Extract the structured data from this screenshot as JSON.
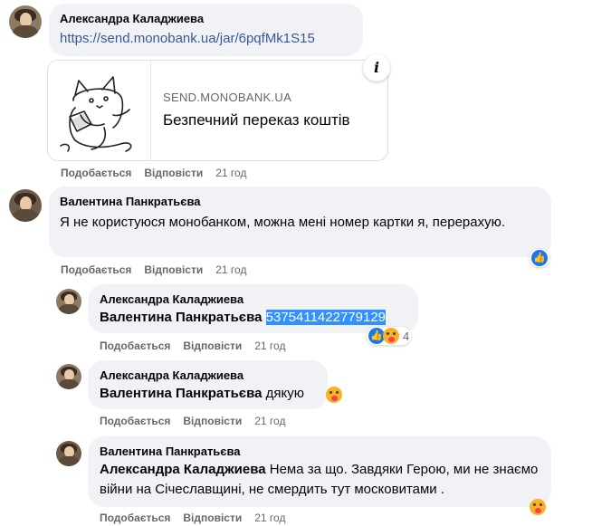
{
  "comments": [
    {
      "author": "Александра Каладжиева",
      "link": "https://send.monobank.ua/jar/6pqfMk1S15",
      "preview": {
        "domain": "SEND.MONOBANK.UA",
        "title": "Безпечний переказ коштів",
        "info_icon": "i"
      },
      "actions": {
        "like": "Подобається",
        "reply": "Відповісти",
        "time": "21 год"
      }
    },
    {
      "author": "Валентина Панкратьєва",
      "text": "Я не користуюся монобанком, можна мені номер картки я, перерахую.",
      "actions": {
        "like": "Подобається",
        "reply": "Відповісти",
        "time": "21 год"
      },
      "reaction": "like-icon"
    }
  ],
  "replies": [
    {
      "author": "Александра Каладжиева",
      "mention": "Валентина Панкратьєва",
      "text": "5375411422779129",
      "actions": {
        "like": "Подобається",
        "reply": "Відповісти",
        "time": "21 год"
      },
      "reaction_count": "4"
    },
    {
      "author": "Александра Каладжиева",
      "mention": "Валентина Панкратьєва",
      "text": "дякую",
      "actions": {
        "like": "Подобається",
        "reply": "Відповісти",
        "time": "21 год"
      }
    },
    {
      "author": "Валентина Панкратьєва",
      "mention": "Александра Каладжиева",
      "text": "Нема за що. Завдяки Герою, ми не знаємо війни на Січеславщині, не смердить тут московитами .",
      "actions": {
        "like": "Подобається",
        "reply": "Відповісти",
        "time": "21 год"
      }
    }
  ],
  "colors": {
    "bubble": "#f0f2f5",
    "link": "#385898",
    "meta": "#65676b",
    "highlight": "#3390ff",
    "like": "#1877f2"
  }
}
